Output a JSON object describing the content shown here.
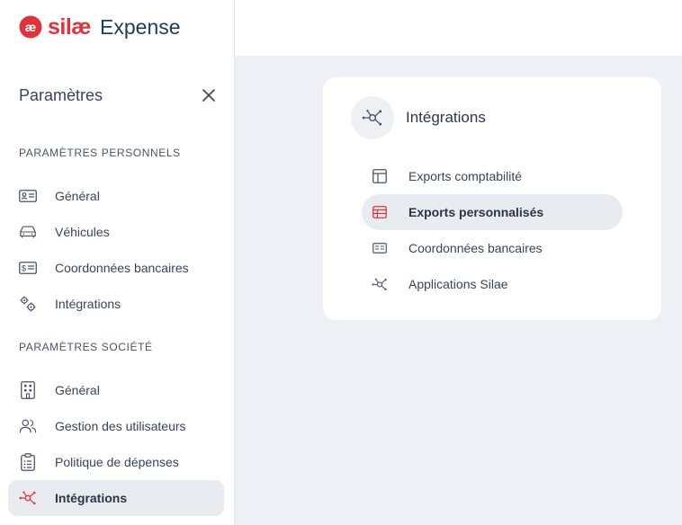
{
  "brand": {
    "word": "silæ",
    "product": "Expense",
    "accent": "#e0323a",
    "navy": "#1f3a5a"
  },
  "sidebar": {
    "title": "Paramètres",
    "personal_section": "PARAMÈTRES PERSONNELS",
    "personal_items": [
      {
        "label": "Général",
        "icon": "id-card-icon"
      },
      {
        "label": "Véhicules",
        "icon": "car-icon"
      },
      {
        "label": "Coordonnées bancaires",
        "icon": "bank-card-icon"
      },
      {
        "label": "Intégrations",
        "icon": "gears-icon"
      }
    ],
    "company_section": "PARAMÈTRES SOCIÉTÉ",
    "company_items": [
      {
        "label": "Général",
        "icon": "building-icon"
      },
      {
        "label": "Gestion des utilisateurs",
        "icon": "users-icon"
      },
      {
        "label": "Politique de dépenses",
        "icon": "clipboard-icon"
      },
      {
        "label": "Intégrations",
        "icon": "network-icon",
        "active": true
      }
    ]
  },
  "card": {
    "title": "Intégrations",
    "icon": "network-icon",
    "items": [
      {
        "label": "Exports comptabilité",
        "icon": "layout-icon"
      },
      {
        "label": "Exports personnalisés",
        "icon": "table-icon",
        "active": true
      },
      {
        "label": "Coordonnées bancaires",
        "icon": "bank-card-icon"
      },
      {
        "label": "Applications Silae",
        "icon": "network-icon"
      }
    ]
  }
}
